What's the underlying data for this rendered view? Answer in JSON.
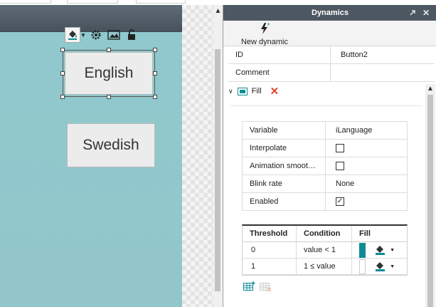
{
  "panel": {
    "title": "Dynamics",
    "toolbar": {
      "new_dynamic": "New dynamic"
    },
    "properties": [
      {
        "key": "ID",
        "value": "Button2"
      },
      {
        "key": "Comment",
        "value": ""
      }
    ],
    "dynamic": {
      "name": "Fill",
      "settings": [
        {
          "key": "Variable",
          "value": "iLanguage"
        },
        {
          "key": "Interpolate",
          "checked": false
        },
        {
          "key": "Animation smoot…",
          "checked": false
        },
        {
          "key": "Blink rate",
          "value": "None"
        },
        {
          "key": "Enabled",
          "checked": true
        }
      ],
      "table": {
        "headers": [
          "Threshold",
          "Condition",
          "Fill"
        ],
        "rows": [
          {
            "threshold": "0",
            "condition": "value < 1",
            "fill_color": "#0e8c96"
          },
          {
            "threshold": "1",
            "condition": "1 ≤ value",
            "fill_color": "#ffffff"
          }
        ]
      }
    }
  },
  "canvas": {
    "buttons": [
      {
        "label": "English"
      },
      {
        "label": "Swedish"
      }
    ],
    "floating_toolbar": [
      "fill-bucket-icon",
      "gear-icon",
      "image-icon",
      "lock-icon"
    ]
  },
  "colors": {
    "canvas_bg": "#8fc9ce",
    "header_dark": "#4e5862",
    "accent_teal": "#0e8c96",
    "delete_red": "#e0452a"
  }
}
